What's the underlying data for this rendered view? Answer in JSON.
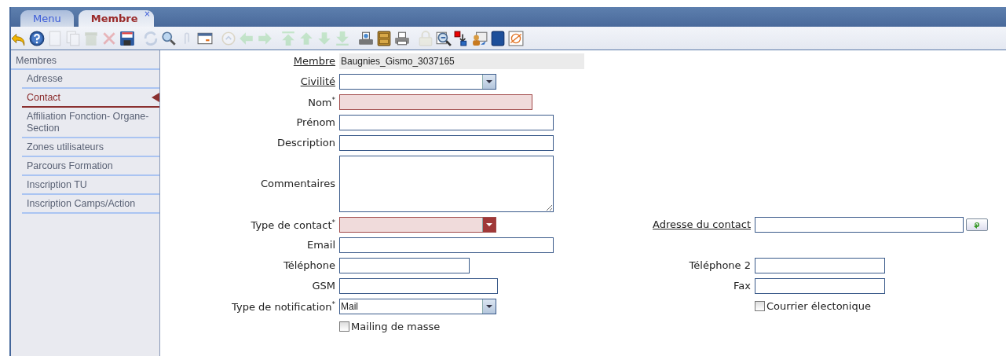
{
  "tabs": [
    {
      "label": "Menu",
      "selected": false
    },
    {
      "label": "Membre",
      "selected": true,
      "close": "×"
    }
  ],
  "toolbar": [
    [
      {
        "kind": "undo",
        "disabled": false
      },
      {
        "kind": "help",
        "disabled": false
      },
      {
        "kind": "new",
        "disabled": true
      },
      {
        "kind": "copy",
        "disabled": true
      },
      {
        "kind": "trash",
        "disabled": true
      },
      {
        "kind": "delete",
        "disabled": true
      },
      {
        "kind": "save",
        "disabled": false
      }
    ],
    [
      {
        "kind": "refresh",
        "disabled": true
      },
      {
        "kind": "search",
        "disabled": false
      },
      {
        "kind": "attach",
        "disabled": true
      },
      {
        "kind": "calendar",
        "disabled": false
      }
    ],
    [
      {
        "kind": "history",
        "disabled": true
      },
      {
        "kind": "prev",
        "disabled": true
      },
      {
        "kind": "next",
        "disabled": true
      }
    ],
    [
      {
        "kind": "first",
        "disabled": true
      },
      {
        "kind": "up",
        "disabled": true
      },
      {
        "kind": "down",
        "disabled": true
      },
      {
        "kind": "last",
        "disabled": true
      }
    ],
    [
      {
        "kind": "scanner",
        "disabled": false
      },
      {
        "kind": "cabinet",
        "disabled": false
      },
      {
        "kind": "printer",
        "disabled": false
      }
    ],
    [
      {
        "kind": "lock",
        "disabled": true
      },
      {
        "kind": "zoom",
        "disabled": false
      },
      {
        "kind": "export",
        "disabled": false
      },
      {
        "kind": "people",
        "disabled": false
      },
      {
        "kind": "book",
        "disabled": false
      },
      {
        "kind": "exo",
        "disabled": false
      }
    ]
  ],
  "sidebar": {
    "header": "Membres",
    "items": [
      {
        "label": "Adresse",
        "selected": false
      },
      {
        "label": "Contact",
        "selected": true
      },
      {
        "label": "Affiliation Fonction- Organe-Section",
        "selected": false
      },
      {
        "label": "Zones utilisateurs",
        "selected": false
      },
      {
        "label": "Parcours Formation",
        "selected": false
      },
      {
        "label": "Inscription TU",
        "selected": false
      },
      {
        "label": "Inscription Camps/Action",
        "selected": false
      }
    ]
  },
  "form": {
    "rows": [
      {
        "left": {
          "label": "Membre",
          "link": true,
          "field": {
            "kind": "readonly",
            "value": "Baugnies_Gismo_3037165"
          }
        }
      },
      {
        "left": {
          "label": "Civilité",
          "link": true,
          "field": {
            "kind": "select",
            "invalid": false
          }
        }
      },
      {
        "left": {
          "label": "Nom$^{*}$",
          "link": false,
          "field": {
            "kind": "text",
            "invalid": true
          }
        }
      },
      {
        "left": {
          "label": "Prénom",
          "link": false,
          "field": {
            "kind": "text",
            "invalid": false
          }
        }
      },
      {
        "left": {
          "label": "Description",
          "link": false,
          "field": {
            "kind": "text",
            "invalid": false
          }
        }
      },
      {
        "left": {
          "label": "Commentaires",
          "link": false,
          "field": {
            "kind": "textarea",
            "invalid": false
          }
        }
      },
      {
        "left": {
          "label": "Type de contact$^{*}$",
          "link": false,
          "field": {
            "kind": "select",
            "invalid": true
          }
        },
        "right": {
          "label": "Adresse du contact",
          "link": true,
          "field": {
            "kind": "lookup",
            "invalid": false
          }
        }
      },
      {
        "left": {
          "label": "Email",
          "link": false,
          "field": {
            "kind": "text",
            "invalid": false
          }
        }
      },
      {
        "left": {
          "label": "Téléphone",
          "link": false,
          "field": {
            "kind": "text",
            "invalid": false
          }
        },
        "right": {
          "label": "Téléphone 2",
          "link": false,
          "field": {
            "kind": "text",
            "invalid": false
          }
        }
      },
      {
        "left": {
          "label": "GSM",
          "link": false,
          "field": {
            "kind": "text",
            "invalid": false
          }
        },
        "right": {
          "label": "Fax",
          "link": false,
          "field": {
            "kind": "text",
            "invalid": false
          }
        }
      },
      {
        "left": {
          "label": "Type de notification$^{*}$",
          "link": false,
          "field": {
            "kind": "select",
            "invalid": false,
            "value": "Mail"
          }
        },
        "right": {
          "field": {
            "kind": "checkbox",
            "checked": false,
            "label": "Courrier électonique"
          }
        }
      },
      {
        "left": {
          "field": {
            "kind": "checkbox",
            "checked": false,
            "label": "Mailing de masse"
          }
        }
      }
    ]
  }
}
